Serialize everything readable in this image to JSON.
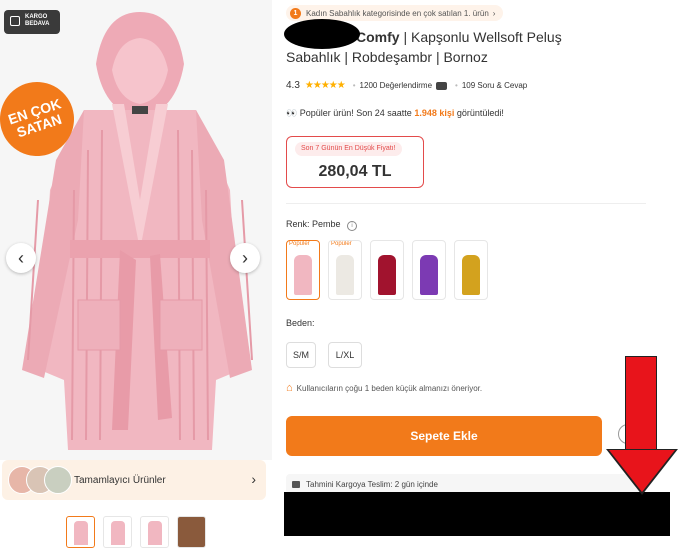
{
  "left": {
    "cargo_badge": {
      "line1": "KARGO",
      "line2": "BEDAVA"
    },
    "seller_badge": {
      "line1": "EN ÇOK",
      "line2": "SATAN"
    },
    "arrows": {
      "prev": "‹",
      "next": "›"
    },
    "complementary": {
      "label": "Tamamlayıcı Ürünler",
      "chevron": "›"
    }
  },
  "product": {
    "best_seller_rank": "1",
    "best_seller_text": "Kadın Sabahlık kategorisinde en çok satılan 1. ürün",
    "best_seller_chev": "›",
    "title_brand": "Comfy",
    "title_rest": " | Kapşonlu Wellsoft Peluş Sabahlık | Robdeşambr | Bornoz",
    "rating_score": "4.3",
    "stars": "★★★★★",
    "reviews": "1200 Değerlendirme",
    "questions": "109 Soru & Cevap",
    "popular_prefix": "Popüler ürün! Son 24 saatte ",
    "popular_count": "1.948 kişi",
    "popular_suffix": " görüntüledi!",
    "price_label": "Son 7 Günün En Düşük Fiyatı!",
    "price": "280,04 TL",
    "color_label": "Renk:",
    "color_value": "Pembe",
    "color_info": "i",
    "swatches": [
      {
        "color": "#f1b7c1",
        "tag": "Popüler"
      },
      {
        "color": "#ece9e3",
        "tag": "Popüler"
      },
      {
        "color": "#a1132e",
        "tag": ""
      },
      {
        "color": "#7c3ab3",
        "tag": ""
      },
      {
        "color": "#d3a21e",
        "tag": ""
      }
    ],
    "size_label": "Beden:",
    "sizes": [
      "S/M",
      "L/XL"
    ],
    "size_hint": "Kullanıcıların çoğu 1 beden küçük almanızı öneriyor.",
    "add_to_cart": "Sepete Ekle",
    "delivery_label": "Tahmini Kargoya Teslim:",
    "delivery_value": "2 gün içinde"
  },
  "colors": {
    "accent": "#f27a1a",
    "price_border": "#e34b4b",
    "annotation_arrow": "#e8141b",
    "robe_pink": "#f1b7c1"
  }
}
